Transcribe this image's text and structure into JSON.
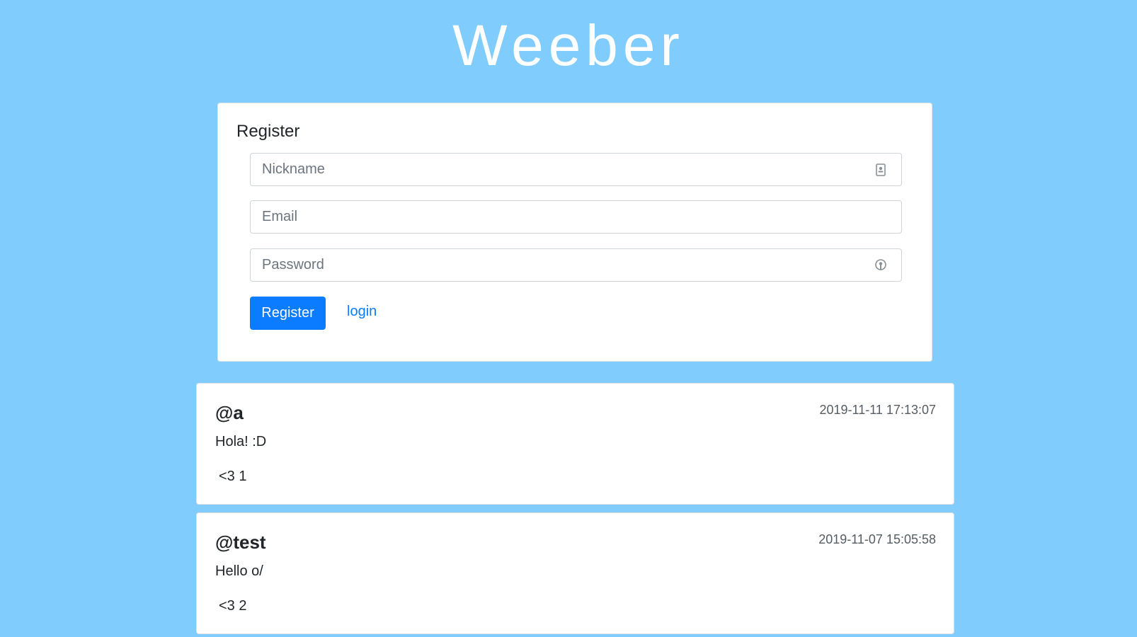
{
  "site": {
    "title": "Weeber"
  },
  "register_form": {
    "heading": "Register",
    "nickname_placeholder": "Nickname",
    "email_placeholder": "Email",
    "password_placeholder": "Password",
    "submit_label": "Register",
    "login_link": "login",
    "nickname_icon": "contact-card-icon",
    "password_icon": "password-key-icon"
  },
  "posts": [
    {
      "author": "@a",
      "timestamp": "2019-11-11 17:13:07",
      "body": "Hola! :D",
      "likes": "<3 1"
    },
    {
      "author": "@test",
      "timestamp": "2019-11-07 15:05:58",
      "body": "Hello o/",
      "likes": "<3 2"
    }
  ],
  "colors": {
    "background": "#80cdfd",
    "primary": "#0b7bff",
    "card": "#ffffff"
  }
}
